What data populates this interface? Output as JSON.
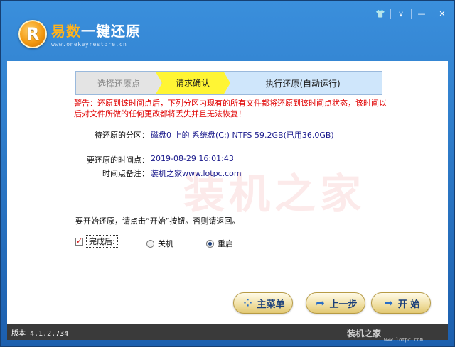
{
  "app": {
    "logo_letter": "R",
    "title_brand": "易数",
    "title_rest": "一键还原",
    "site": "www.onekeyrestore.cn"
  },
  "titlebar_controls": {
    "shirt_icon": "👕",
    "menu_icon": "⊽",
    "minimize": "—",
    "close": "✕"
  },
  "steps": [
    {
      "label": "选择还原点",
      "state": "done"
    },
    {
      "label": "请求确认",
      "state": "active"
    },
    {
      "label": "执行还原(自动运行)",
      "state": "pending"
    }
  ],
  "warning": "警告：还原到该时间点后，下列分区内现有的所有文件都将还原到该时间点状态，该时间以后对文件所做的任何更改都将丢失并且无法恢复！",
  "details": {
    "partition_label": "待还原的分区：",
    "partition_value": "磁盘0 上的 系统盘(C:) NTFS 59.2GB(已用36.0GB)",
    "time_label": "要还原的时间点：",
    "time_value": "2019-08-29 16:01:43",
    "note_label": "时间点备注：",
    "note_value": "装机之家www.lotpc.com"
  },
  "prompt": "要开始还原，请点击“开始”按钮。否则请返回。",
  "after": {
    "checkbox_label": "完成后:",
    "checked": true,
    "options": [
      "关机",
      "重启"
    ],
    "selected": "重启"
  },
  "watermark": "装机之家",
  "buttons": {
    "menu": "主菜单",
    "prev": "上一步",
    "start": "开 始"
  },
  "status": {
    "version": "版本 4.1.2.734",
    "watermark": "装机之家",
    "watermark_url": "www.lotpc.com"
  }
}
